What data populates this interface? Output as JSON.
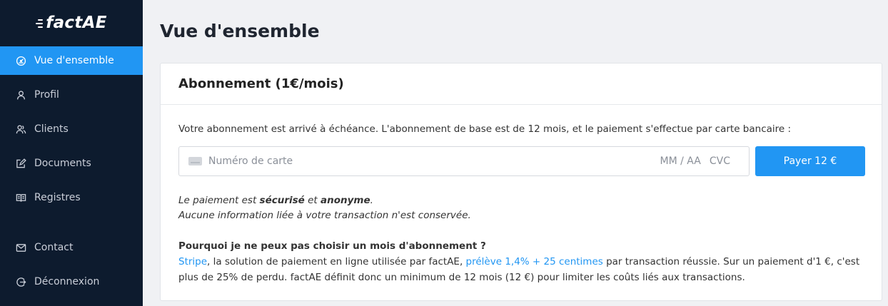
{
  "app": {
    "logo": "factAE"
  },
  "sidebar": {
    "items": [
      {
        "label": "Vue d'ensemble",
        "icon": "dashboard-icon"
      },
      {
        "label": "Profil",
        "icon": "user-icon"
      },
      {
        "label": "Clients",
        "icon": "users-icon"
      },
      {
        "label": "Documents",
        "icon": "edit-icon"
      },
      {
        "label": "Registres",
        "icon": "book-icon"
      },
      {
        "label": "Contact",
        "icon": "mail-icon"
      },
      {
        "label": "Déconnexion",
        "icon": "logout-icon"
      }
    ]
  },
  "page": {
    "title": "Vue d'ensemble"
  },
  "subscription": {
    "title": "Abonnement (1€/mois)",
    "intro": "Votre abonnement est arrivé à échéance. L'abonnement de base est de 12 mois, et le paiement s'effectue par carte bancaire :",
    "card_number_placeholder": "Numéro de carte",
    "expiry_placeholder": "MM / AA",
    "cvc_placeholder": "CVC",
    "pay_label": "Payer 12 €",
    "note_prefix": "Le paiement est ",
    "note_secure": "sécurisé",
    "note_mid": " et ",
    "note_anon": "anonyme",
    "note_end": ".",
    "note_line2": "Aucune information liée à votre transaction n'est conservée.",
    "faq_question": "Pourquoi je ne peux pas choisir un mois d'abonnement ?",
    "faq_link1": "Stripe",
    "faq_text1": ", la solution de paiement en ligne utilisée par factAE, ",
    "faq_link2": "prélève 1,4% + 25 centimes",
    "faq_text2": " par transaction réussie. Sur un paiement d'1 €, c'est plus de 25% de perdu. factAE définit donc un minimum de 12 mois (12 €) pour limiter les coûts liés aux transactions."
  },
  "colors": {
    "sidebar_bg": "#0d1b2e",
    "accent": "#2196f3",
    "page_bg": "#f0f1f4"
  }
}
